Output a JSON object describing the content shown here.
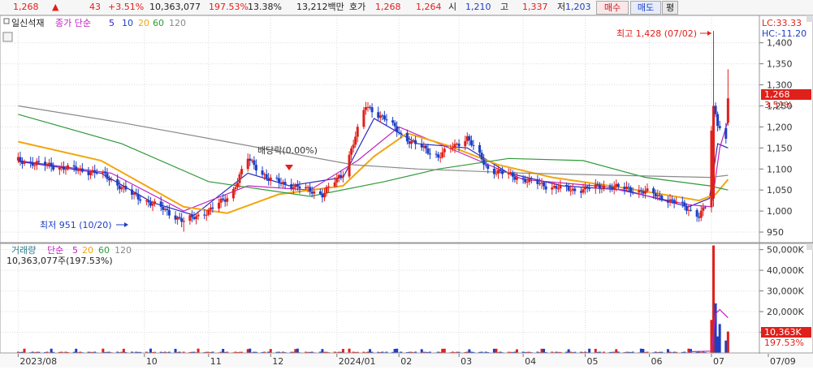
{
  "quote": {
    "price": "1,268",
    "change_arrow": "▲",
    "change": "43",
    "change_pct": "+3.51%",
    "volume": "10,363,077",
    "volume_ratio": "197.53%",
    "turnover": "13.38%",
    "amount": "13,212백만",
    "hoga_label": "호가",
    "ask": "1,268",
    "bid": "1,264",
    "open_label": "시",
    "open": "1,210",
    "high_label": "고",
    "high": "1,337",
    "low_label": "저",
    "low": "1,203",
    "buy_button": "매수",
    "sell_button": "매도",
    "eval_button": "평"
  },
  "colors": {
    "up": "#e0201b",
    "down": "#1d3fc4",
    "ma5": "#2a2abf",
    "ma10": "#c020c0",
    "ma20": "#f2a60e",
    "ma60": "#2f9a3a",
    "ma120": "#8a8a8a",
    "grid": "#dcdcdc"
  },
  "price_panel": {
    "title": "일신석재",
    "legend_prefix": "종가 단순",
    "legend_periods": [
      "5",
      "10",
      "20",
      "60",
      "120"
    ],
    "lc_label": "LC:33.33",
    "hc_label": "HC:-11.20",
    "current_price_tag": "1,268",
    "current_pct_tag": "3.51%",
    "high_annotation": "최고 1,428 (07/02)",
    "low_annotation": "최저 951 (10/20)",
    "dividend_annotation": "배당락(0.00%)"
  },
  "volume_panel": {
    "title": "거래량",
    "legend_prefix": "단순",
    "legend_periods": [
      "5",
      "20",
      "60",
      "120"
    ],
    "summary": "10,363,077주(197.53%)",
    "current_tag": "10,363K",
    "current_pct": "197.53%"
  },
  "chart_data": {
    "type": "candlestick",
    "y_axis_price": {
      "ticks": [
        "950",
        "1,000",
        "1,050",
        "1,100",
        "1,150",
        "1,200",
        "1,250",
        "1,300",
        "1,350",
        "1,400"
      ],
      "range": [
        925,
        1465
      ]
    },
    "y_axis_volume": {
      "ticks": [
        "10,000K",
        "20,000K",
        "30,000K",
        "40,000K",
        "50,000K"
      ],
      "range": [
        0,
        53000
      ]
    },
    "x_axis": {
      "labels": [
        {
          "text": "2023/08",
          "x": "2023-08-01"
        },
        {
          "text": "10",
          "x": "2023-10-01"
        },
        {
          "text": "11",
          "x": "2023-11-01"
        },
        {
          "text": "12",
          "x": "2023-12-01"
        },
        {
          "text": "2024/01",
          "x": "2024-01-02"
        },
        {
          "text": "02",
          "x": "2024-02-01"
        },
        {
          "text": "03",
          "x": "2024-03-01"
        },
        {
          "text": "04",
          "x": "2024-04-01"
        },
        {
          "text": "05",
          "x": "2024-05-01"
        },
        {
          "text": "06",
          "x": "2024-06-01"
        },
        {
          "text": "07",
          "x": "2024-07-01"
        },
        {
          "text": "07/09",
          "x": "2024-07-09"
        }
      ]
    },
    "price_trend": [
      [
        "2023-08-01",
        1120
      ],
      [
        "2023-08-20",
        1105
      ],
      [
        "2023-09-10",
        1090
      ],
      [
        "2023-09-25",
        1040
      ],
      [
        "2023-10-10",
        1005
      ],
      [
        "2023-10-20",
        975
      ],
      [
        "2023-11-01",
        1000
      ],
      [
        "2023-11-12",
        1040
      ],
      [
        "2023-11-20",
        1125
      ],
      [
        "2023-11-30",
        1075
      ],
      [
        "2023-12-12",
        1060
      ],
      [
        "2023-12-26",
        1040
      ],
      [
        "2024-01-05",
        1090
      ],
      [
        "2024-01-16",
        1250
      ],
      [
        "2024-01-25",
        1220
      ],
      [
        "2024-02-05",
        1170
      ],
      [
        "2024-02-20",
        1130
      ],
      [
        "2024-03-05",
        1175
      ],
      [
        "2024-03-15",
        1100
      ],
      [
        "2024-03-29",
        1080
      ],
      [
        "2024-04-12",
        1060
      ],
      [
        "2024-04-25",
        1050
      ],
      [
        "2024-05-12",
        1060
      ],
      [
        "2024-05-31",
        1045
      ],
      [
        "2024-06-14",
        1020
      ],
      [
        "2024-06-25",
        990
      ],
      [
        "2024-06-28",
        1010
      ],
      [
        "2024-07-02",
        1250
      ],
      [
        "2024-07-04",
        1210
      ],
      [
        "2024-07-08",
        1170
      ],
      [
        "2024-07-09",
        1268
      ]
    ],
    "moving_averages": [
      {
        "name": "5",
        "color": "#2a2abf",
        "points": [
          [
            "2023-08-01",
            1118
          ],
          [
            "2023-09-10",
            1090
          ],
          [
            "2023-10-05",
            1020
          ],
          [
            "2023-10-25",
            990
          ],
          [
            "2023-11-20",
            1090
          ],
          [
            "2023-12-10",
            1060
          ],
          [
            "2024-01-05",
            1080
          ],
          [
            "2024-01-20",
            1220
          ],
          [
            "2024-02-10",
            1160
          ],
          [
            "2024-03-05",
            1150
          ],
          [
            "2024-03-25",
            1090
          ],
          [
            "2024-04-20",
            1060
          ],
          [
            "2024-05-20",
            1050
          ],
          [
            "2024-06-20",
            1010
          ],
          [
            "2024-06-30",
            1030
          ],
          [
            "2024-07-04",
            1160
          ],
          [
            "2024-07-09",
            1150
          ]
        ]
      },
      {
        "name": "10",
        "color": "#c020c0",
        "points": [
          [
            "2023-08-01",
            1120
          ],
          [
            "2023-09-15",
            1090
          ],
          [
            "2023-10-20",
            1000
          ],
          [
            "2023-11-20",
            1060
          ],
          [
            "2023-12-20",
            1050
          ],
          [
            "2024-01-12",
            1120
          ],
          [
            "2024-02-01",
            1200
          ],
          [
            "2024-03-01",
            1140
          ],
          [
            "2024-04-01",
            1075
          ],
          [
            "2024-05-10",
            1058
          ],
          [
            "2024-06-20",
            1015
          ],
          [
            "2024-07-01",
            1010
          ],
          [
            "2024-07-05",
            1150
          ],
          [
            "2024-07-09",
            1215
          ]
        ]
      },
      {
        "name": "20",
        "color": "#f2a60e",
        "points": [
          [
            "2023-08-01",
            1165
          ],
          [
            "2023-09-10",
            1120
          ],
          [
            "2023-10-20",
            1010
          ],
          [
            "2023-11-10",
            995
          ],
          [
            "2023-12-05",
            1040
          ],
          [
            "2024-01-05",
            1060
          ],
          [
            "2024-01-20",
            1130
          ],
          [
            "2024-02-05",
            1185
          ],
          [
            "2024-02-25",
            1155
          ],
          [
            "2024-03-20",
            1110
          ],
          [
            "2024-04-15",
            1080
          ],
          [
            "2024-05-20",
            1055
          ],
          [
            "2024-06-25",
            1025
          ],
          [
            "2024-07-03",
            1040
          ],
          [
            "2024-07-09",
            1075
          ]
        ]
      },
      {
        "name": "60",
        "color": "#2f9a3a",
        "points": [
          [
            "2023-08-01",
            1230
          ],
          [
            "2023-09-20",
            1160
          ],
          [
            "2023-11-01",
            1070
          ],
          [
            "2023-12-20",
            1035
          ],
          [
            "2024-01-25",
            1070
          ],
          [
            "2024-02-20",
            1100
          ],
          [
            "2024-03-25",
            1125
          ],
          [
            "2024-04-30",
            1120
          ],
          [
            "2024-05-30",
            1080
          ],
          [
            "2024-06-30",
            1060
          ],
          [
            "2024-07-09",
            1050
          ]
        ]
      },
      {
        "name": "120",
        "color": "#8a8a8a",
        "points": [
          [
            "2023-08-01",
            1250
          ],
          [
            "2023-09-20",
            1210
          ],
          [
            "2023-11-15",
            1160
          ],
          [
            "2024-01-10",
            1110
          ],
          [
            "2024-02-10",
            1100
          ],
          [
            "2024-04-01",
            1090
          ],
          [
            "2024-05-15",
            1085
          ],
          [
            "2024-06-30",
            1080
          ],
          [
            "2024-07-09",
            1085
          ]
        ]
      }
    ],
    "highest": {
      "date": "2024-07-02",
      "value": 1428
    },
    "lowest": {
      "date": "2023-10-20",
      "value": 951
    },
    "last_close": 1268,
    "last_volume_k": 10363,
    "volume_spikes": [
      [
        "2024-07-01",
        16000
      ],
      [
        "2024-07-02",
        52000
      ],
      [
        "2024-07-03",
        24000
      ],
      [
        "2024-07-04",
        8000
      ],
      [
        "2024-07-05",
        14000
      ],
      [
        "2024-07-08",
        6000
      ],
      [
        "2024-07-09",
        10363
      ]
    ]
  }
}
